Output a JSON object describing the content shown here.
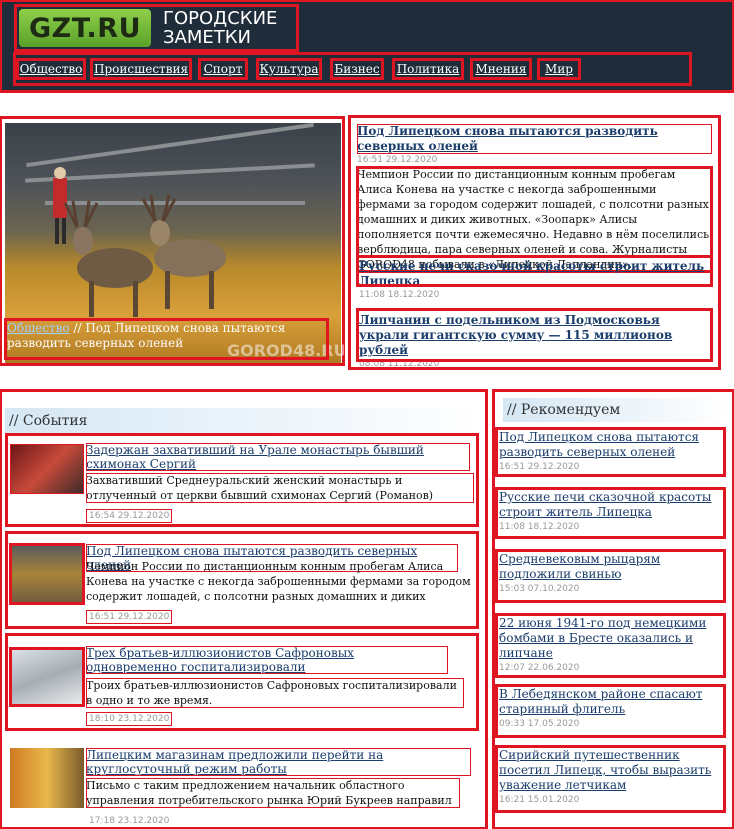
{
  "logo": {
    "badge": "GZT.RU",
    "line1": "ГОРОДСКИЕ",
    "line2": "ЗАМЕТКИ"
  },
  "nav": [
    "Общество",
    "Происшествия",
    "Спорт",
    "Культура",
    "Бизнес",
    "Политика",
    "Мнения",
    "Мир"
  ],
  "hero": {
    "category": "Общество",
    "separator": " // ",
    "title": "Под Липецком снова пытаются разводить северных оленей",
    "watermark": "GOROD48.RU"
  },
  "toplist": [
    {
      "title": "Под Липецком снова пытаются разводить северных оленей",
      "date": "16:51 29.12.2020",
      "text": "Чемпион России по дистанционным конным пробегам Алиса Конева на участке с некогда заброшенными фермами за городом содержит лошадей, с полсотни разных домашних и диких животных. «Зоопарк» Алисы пополняется почти ежемесячно. Недавно в нём поселились верблюдица, пара северных оленей и сова. Журналисты GOROD48 побывали в «Липецкой Лапландии»."
    },
    {
      "title": "Русские печи сказочной красоты строит житель Липецка",
      "date": "11:08 18.12.2020"
    },
    {
      "title": "Липчанин с подельником из Подмосковья украли гигантскую сумму — 115 миллионов рублей",
      "date": "08:08 11.12.2020"
    }
  ],
  "events": {
    "heading": "// События",
    "items": [
      {
        "title": "Задержан захвативший на Урале монастырь бывший схимонах Сергий",
        "text": "Захвативший Среднеуральский женский монастырь и отлученный от церкви бывший схимонах Сергий (Романов) задержан для дачи показаний.",
        "date": "16:54 29.12.2020"
      },
      {
        "title": "Под Липецком снова пытаются разводить северных оленей",
        "text": "Чемпион России по дистанционным конным пробегам Алиса Конева на участке с некогда заброшенными фермами за городом содержит лошадей, с полсотни разных домашних и диких животных. «Зоопарк» Алисы пополняется почти ежемесячно.",
        "date": "16:51 29.12.2020"
      },
      {
        "title": "Трех братьев-иллюзионистов Сафроновых одновременно госпитализировали",
        "text": "Троих братьев-иллюзионистов Сафроновых госпитализировали в одно и то же время.",
        "date": "18:10 23.12.2020"
      },
      {
        "title": "Липецким магазинам предложили перейти на круглосуточный режим работы",
        "text": "Письмо с таким предложением начальник областного управления потребительского рынка Юрий Букреев направил в торговые организации.",
        "date": "17:18 23.12.2020"
      }
    ]
  },
  "recommend": {
    "heading": "// Рекомендуем",
    "items": [
      {
        "title": "Под Липецком снова пытаются разводить северных оленей",
        "date": "16:51 29.12.2020"
      },
      {
        "title": "Русские печи сказочной красоты строит житель Липецка",
        "date": "11:08 18.12.2020"
      },
      {
        "title": "Средневековым рыцарям подложили свинью",
        "date": "15:03 07.10.2020"
      },
      {
        "title": "22 июня 1941-го под немецкими бомбами в Бресте оказались и липчане",
        "date": "12:07 22.06.2020"
      },
      {
        "title": "В Лебедянском районе спасают старинный флигель",
        "date": "09:33 17.05.2020"
      },
      {
        "title": "Сирийский путешественник посетил Липецк, чтобы выразить уважение летчикам",
        "date": "16:21 15.01.2020"
      }
    ]
  },
  "colors": {
    "header_bg": "#1f2c3a",
    "logo_green": "#6bb536",
    "link": "#1a3d6b",
    "highlight": "#e01522"
  }
}
